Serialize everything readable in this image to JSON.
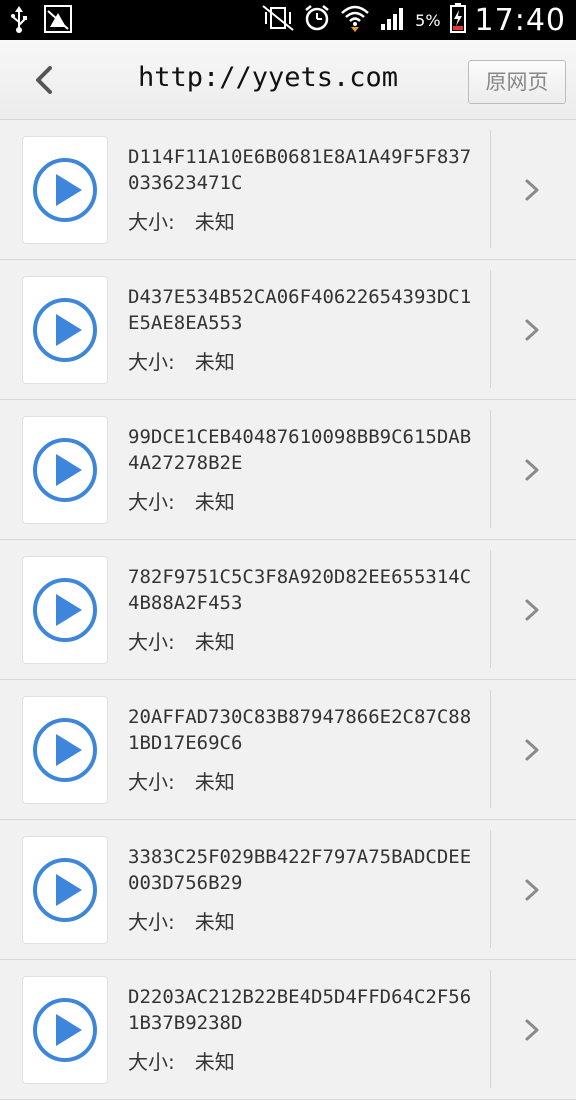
{
  "status_bar": {
    "battery_percent": "5%",
    "time": "17:40",
    "icons": [
      "usb-icon",
      "notification-app-icon",
      "vibrate-icon",
      "alarm-icon",
      "wifi-icon",
      "signal-icon",
      "battery-icon"
    ]
  },
  "titlebar": {
    "title": "http://yyets.com",
    "original_page_label": "原网页"
  },
  "items": [
    {
      "name": "D114F11A10E6B0681E8A1A49F5F837033623471C",
      "size_label": "大小:",
      "size_value": "未知"
    },
    {
      "name": "D437E534B52CA06F40622654393DC1E5AE8EA553",
      "size_label": "大小:",
      "size_value": "未知"
    },
    {
      "name": "99DCE1CEB40487610098BB9C615DAB4A27278B2E",
      "size_label": "大小:",
      "size_value": "未知"
    },
    {
      "name": "782F9751C5C3F8A920D82EE655314C4B88A2F453",
      "size_label": "大小:",
      "size_value": "未知"
    },
    {
      "name": "20AFFAD730C83B87947866E2C87C881BD17E69C6",
      "size_label": "大小:",
      "size_value": "未知"
    },
    {
      "name": "3383C25F029BB422F797A75BADCDEE003D756B29",
      "size_label": "大小:",
      "size_value": "未知"
    },
    {
      "name": "D2203AC212B22BE4D5D4FFD64C2F561B37B9238D",
      "size_label": "大小:",
      "size_value": "未知"
    }
  ],
  "colors": {
    "play_icon": "#3d86dc",
    "background": "#f1f1f1",
    "status_bar": "#000000"
  }
}
